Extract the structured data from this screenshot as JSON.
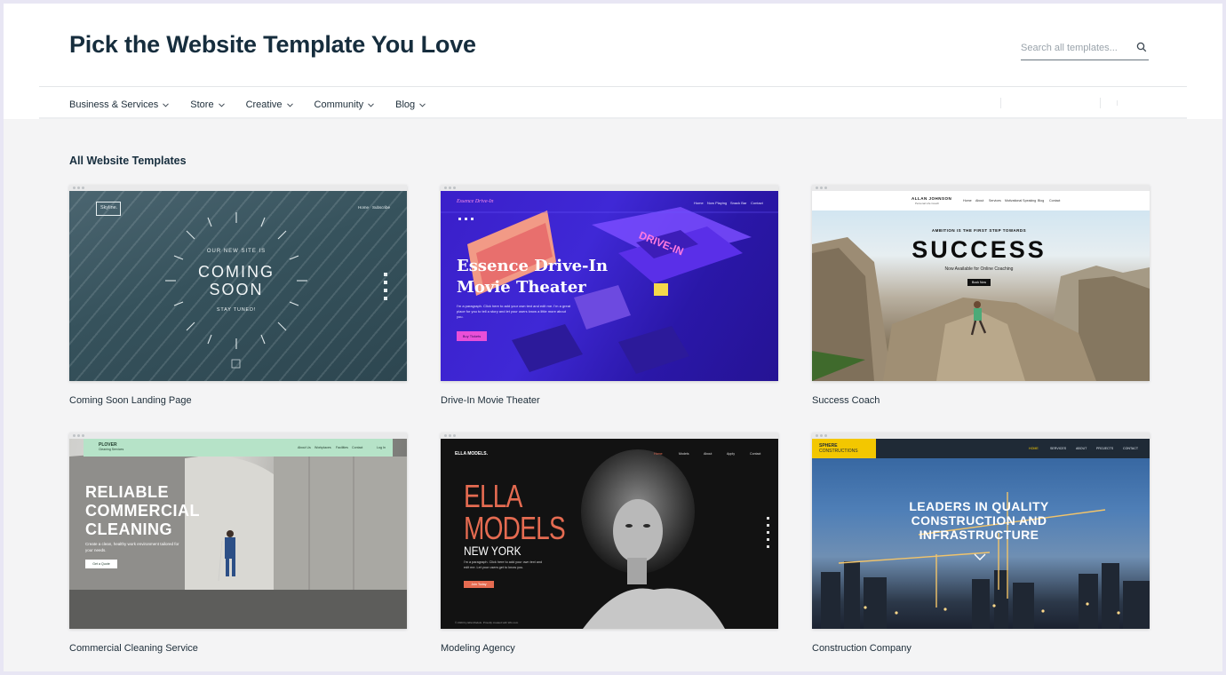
{
  "header": {
    "title": "Pick the Website Template You Love",
    "search_placeholder": "Search all templates..."
  },
  "nav": [
    {
      "label": "Business & Services"
    },
    {
      "label": "Store"
    },
    {
      "label": "Creative"
    },
    {
      "label": "Community"
    },
    {
      "label": "Blog"
    }
  ],
  "section_title": "All Website Templates",
  "templates": [
    {
      "name": "Coming Soon Landing Page",
      "preview": {
        "logo": "Skyline.",
        "menu": [
          "Home",
          "Subscribe"
        ],
        "kicker": "OUR NEW SITE IS",
        "headline_1": "COMING",
        "headline_2": "SOON",
        "sub": "STAY TUNED!"
      }
    },
    {
      "name": "Drive-In Movie Theater",
      "preview": {
        "logo": "Essence Drive-In",
        "menu": [
          "Home",
          "Now Playing",
          "Snack Bar",
          "Contact"
        ],
        "headline_1": "Essence Drive-In",
        "headline_2": "Movie Theater",
        "body": "I'm a paragraph. Click here to add your own text and edit me. I'm a great place for you to tell a story and let your users know a little more about you.",
        "cta": "Buy Tickets",
        "sign": "DRIVE-IN"
      }
    },
    {
      "name": "Success Coach",
      "preview": {
        "logo": "ALLAN JOHNSON",
        "tagline": "Personal Life Coach",
        "menu": [
          "Home",
          "About",
          "Services",
          "Motivational Speaking",
          "Blog",
          "Contact"
        ],
        "kicker": "AMBITION IS THE FIRST STEP TOWARDS",
        "headline": "SUCCESS",
        "sub": "Now Available for Online Coaching",
        "cta": "Book Now"
      }
    },
    {
      "name": "Commercial Cleaning Service",
      "preview": {
        "logo": "PLOVER",
        "tagline": "Cleaning Services",
        "menu": [
          "About Us",
          "Workplaces",
          "Facilities",
          "Contact"
        ],
        "login": "Log In",
        "headline_1": "RELIABLE",
        "headline_2": "COMMERCIAL",
        "headline_3": "CLEANING",
        "body": "Create a clean, healthy work environment tailored for your needs.",
        "cta": "Get a Quote"
      }
    },
    {
      "name": "Modeling Agency",
      "preview": {
        "logo": "ELLA MODELS.",
        "menu": [
          "Home",
          "Models",
          "About",
          "Apply",
          "Contact"
        ],
        "headline_1": "ELLA",
        "headline_2": "MODELS",
        "city": "NEW YORK",
        "body": "I'm a paragraph. Click here to add your own text and edit me. Let your users get to know you.",
        "cta": "Join Today",
        "footer": "© 2023 by Ella Models. Proudly created with Wix.com"
      }
    },
    {
      "name": "Construction Company",
      "preview": {
        "logo_1": "SPHERE",
        "logo_2": "CONSTRUCTIONS",
        "menu": [
          "HOME",
          "SERVICES",
          "ABOUT",
          "PROJECTS",
          "CONTACT"
        ],
        "headline_1": "LEADERS IN QUALITY",
        "headline_2": "CONSTRUCTION AND",
        "headline_3": "INFRASTRUCTURE"
      }
    }
  ],
  "colors": {
    "page_bg": "#f4f4f5",
    "header_bg": "#ffffff",
    "title_text": "#162d3d",
    "body_text": "#20303c",
    "drivein_accent": "#e94fd8",
    "models_accent": "#e56b51",
    "cleaning_bar": "#b6e3c8",
    "construct_logo_bg": "#f3c700"
  }
}
